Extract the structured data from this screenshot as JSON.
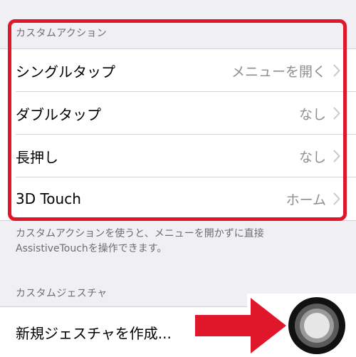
{
  "custom_actions": {
    "header": "カスタムアクション",
    "rows": [
      {
        "label": "シングルタップ",
        "value": "メニューを開く"
      },
      {
        "label": "ダブルタップ",
        "value": "なし"
      },
      {
        "label": "長押し",
        "value": "なし"
      },
      {
        "label": "3D Touch",
        "value": "ホーム"
      }
    ],
    "footer_line1": "カスタムアクションを使うと、メニューを開かずに直接",
    "footer_line2": "AssistiveTouchを操作できます。"
  },
  "custom_gestures": {
    "header": "カスタムジェスチャ",
    "create_label": "新規ジェスチャを作成..."
  },
  "icons": {
    "chevron": "chevron-right-icon",
    "arrow": "red-arrow-icon",
    "assistive": "assistive-touch-icon"
  },
  "colors": {
    "highlight": "#e0162b",
    "background": "#efeff4",
    "secondary_text": "#8e8e93",
    "header_text": "#6d6d72"
  }
}
